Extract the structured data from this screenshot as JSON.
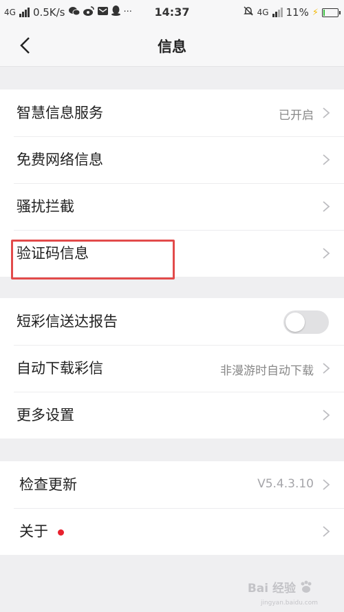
{
  "status_bar": {
    "network_left": "4G",
    "speed": "0.5K/s",
    "time": "14:37",
    "network_right": "4G",
    "battery_percent": "11%",
    "battery_level": 0.11,
    "icons": [
      "signal-icon",
      "wechat-icon",
      "weibo-icon",
      "mail-icon",
      "qq-icon",
      "more-icon",
      "mute-bell-icon",
      "signal-icon",
      "battery-icon",
      "charging-icon"
    ]
  },
  "header": {
    "title": "信息",
    "back_icon": "chevron-left-icon"
  },
  "group1": {
    "items": [
      {
        "label": "智慧信息服务",
        "value": "已开启"
      },
      {
        "label": "免费网络信息",
        "value": ""
      },
      {
        "label": "骚扰拦截",
        "value": ""
      },
      {
        "label": "验证码信息",
        "value": ""
      }
    ]
  },
  "group2": {
    "items": [
      {
        "label": "短彩信送达报告",
        "toggle_on": false
      },
      {
        "label": "自动下载彩信",
        "value": "非漫游时自动下载"
      },
      {
        "label": "更多设置",
        "value": ""
      }
    ]
  },
  "group3": {
    "items": [
      {
        "label": "检查更新",
        "value": "V5.4.3.10"
      },
      {
        "label": "关于",
        "badge": "red-dot"
      }
    ]
  },
  "colors": {
    "background": "#efeff1",
    "highlight_box": "#e24a4a",
    "red_dot": "#e8212e",
    "toggle_off": "#e1e1e3"
  },
  "watermark": {
    "text": "Bai 经验",
    "sub": "jingyan.baidu.com"
  }
}
